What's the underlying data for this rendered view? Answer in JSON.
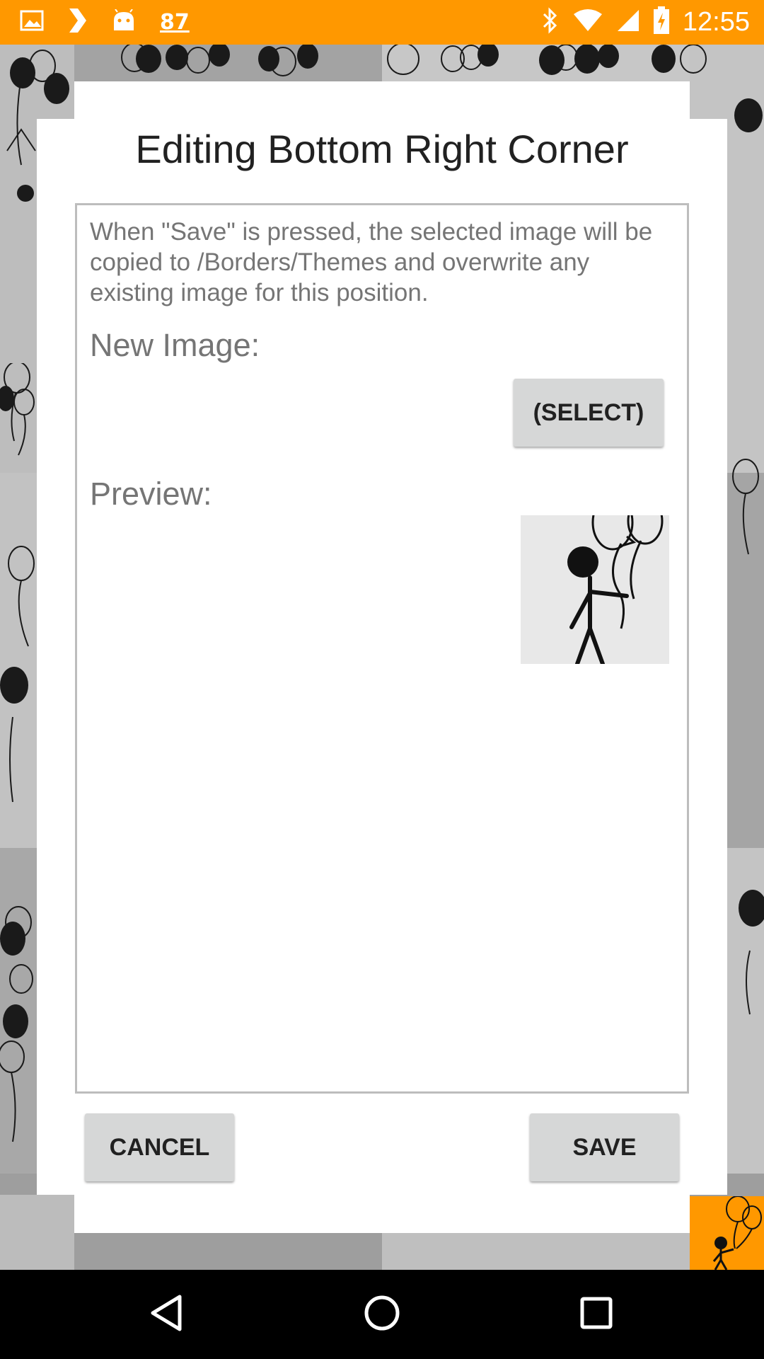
{
  "status_bar": {
    "icons": [
      "image-icon",
      "chevron-right-icon",
      "android-icon",
      "bluetooth-icon",
      "wifi-icon",
      "cell-signal-icon",
      "battery-charging-icon"
    ],
    "badge": "87",
    "time": "12:55",
    "accent": "#ff9800"
  },
  "dialog": {
    "title": "Editing Bottom Right Corner",
    "info": "When \"Save\" is pressed, the selected image will be copied to /Borders/Themes and overwrite any existing image for this position.",
    "new_image_label": "New Image:",
    "select_button": "(SELECT)",
    "preview_label": "Preview:",
    "cancel_button": "CANCEL",
    "save_button": "SAVE"
  },
  "nav_bar": {
    "icons": [
      "back-icon",
      "home-icon",
      "recents-icon"
    ]
  }
}
